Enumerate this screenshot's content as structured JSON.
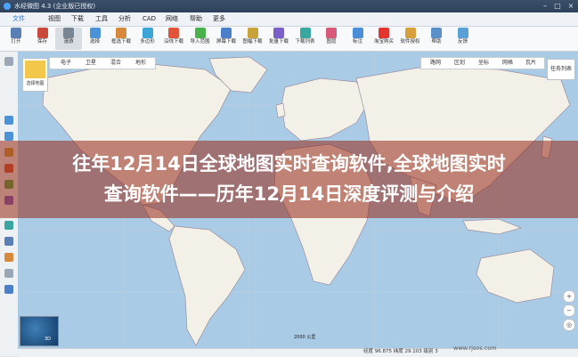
{
  "window": {
    "title": "水经微图 4.3 (企业版已授权)"
  },
  "menu": [
    {
      "label": "文件"
    },
    {
      "label": "视图"
    },
    {
      "label": "下载"
    },
    {
      "label": "工具"
    },
    {
      "label": "分析"
    },
    {
      "label": "CAD"
    },
    {
      "label": "网络"
    },
    {
      "label": "帮助"
    },
    {
      "label": "更多"
    }
  ],
  "toolbar": [
    {
      "label": "打开",
      "color": "#5a7fb5"
    },
    {
      "label": "保存",
      "color": "#c94a3a"
    },
    {
      "label": "漫游",
      "color": "#7a8593"
    },
    {
      "label": "选择",
      "color": "#4c92d6"
    },
    {
      "label": "框选下载",
      "color": "#d8883a"
    },
    {
      "label": "多边形",
      "color": "#3aa6d8"
    },
    {
      "label": "沿线下载",
      "color": "#e2543a"
    },
    {
      "label": "导入范围",
      "color": "#4ab04a"
    },
    {
      "label": "屏幕下载",
      "color": "#4c7fc9"
    },
    {
      "label": "图幅下载",
      "color": "#c9a33a"
    },
    {
      "label": "批量下载",
      "color": "#7a5fc9"
    },
    {
      "label": "下载列表",
      "color": "#3aa6a0"
    },
    {
      "label": "图层",
      "color": "#d85a7a"
    },
    {
      "label": "标注",
      "color": "#4a8fd6"
    },
    {
      "label": "淘宝购买",
      "color": "#e3342f"
    },
    {
      "label": "软件授权",
      "color": "#d8a03a"
    },
    {
      "label": "帮助",
      "color": "#5a8fc9"
    },
    {
      "label": "反馈",
      "color": "#5aa0d6"
    }
  ],
  "map_tabs_left": [
    {
      "label": "电子"
    },
    {
      "label": "卫星"
    },
    {
      "label": "混合"
    },
    {
      "label": "地形"
    }
  ],
  "map_tabs_right": [
    {
      "label": "路网"
    },
    {
      "label": "区划"
    },
    {
      "label": "坐标"
    },
    {
      "label": "网格"
    },
    {
      "label": "瓦片"
    }
  ],
  "layer_list_label": "任务列表",
  "thumbnail_caption": "选择地图",
  "minimap_label": "3D",
  "scale_labels": [
    "2000 公里"
  ],
  "status": {
    "coords": "经度 96.875   纬度 29.103   级别 3"
  },
  "watermark": "www.rjsos.com",
  "headline": {
    "line1": "往年12月14日全球地图实时查询软件,全球地图实时",
    "line2": "查询软件——历年12月14日深度评测与介绍"
  },
  "colors": {
    "map_water": "#aacbe6",
    "map_land": "#f3f0e8",
    "overlay": "#962814"
  }
}
